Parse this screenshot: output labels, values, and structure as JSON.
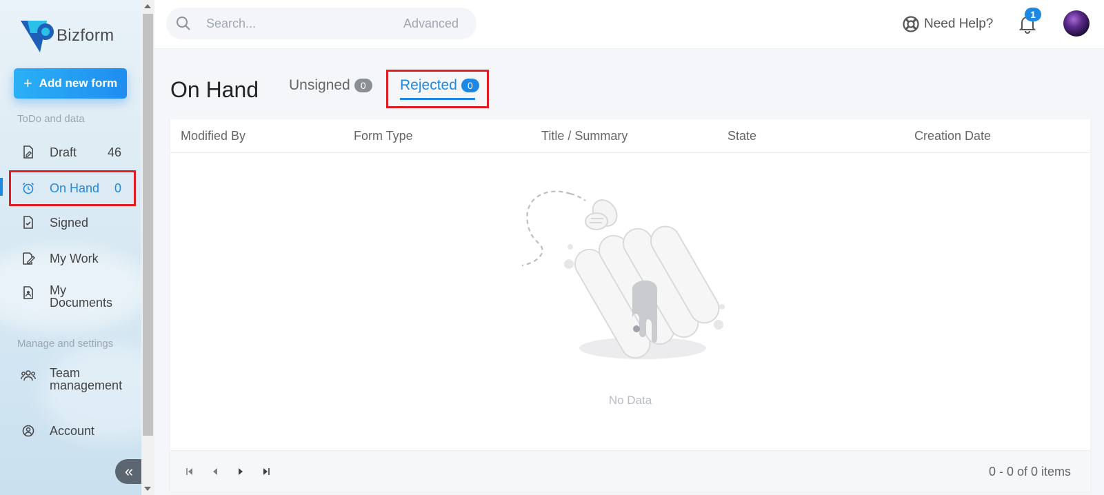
{
  "app": {
    "name": "Bizform"
  },
  "sidebar": {
    "add_button_label": "Add new form",
    "section_todo": "ToDo and data",
    "section_manage": "Manage and settings",
    "items": [
      {
        "label": "Draft",
        "count": "46",
        "icon": "file-edit-icon"
      },
      {
        "label": "On Hand",
        "count": "0",
        "icon": "alarm-clock-icon"
      },
      {
        "label": "Signed",
        "icon": "file-check-icon"
      },
      {
        "label": "My Work",
        "icon": "pen-document-icon"
      },
      {
        "label_line1": "My",
        "label_line2": "Documents",
        "icon": "document-user-icon"
      },
      {
        "label_line1": "Team",
        "label_line2": "management",
        "icon": "team-icon"
      },
      {
        "label": "Account",
        "icon": "user-circle-icon"
      }
    ]
  },
  "header": {
    "search_placeholder": "Search...",
    "advanced_label": "Advanced",
    "help_label": "Need Help?",
    "notification_count": "1"
  },
  "main": {
    "title": "On Hand",
    "tabs": [
      {
        "label": "Unsigned",
        "count": "0"
      },
      {
        "label": "Rejected",
        "count": "0",
        "active": true
      }
    ],
    "table": {
      "columns": [
        "Modified By",
        "Form Type",
        "Title / Summary",
        "State",
        "Creation Date"
      ],
      "rows": [],
      "empty_text": "No Data",
      "pagination_info": "0 - 0 of 0 items"
    }
  },
  "colors": {
    "accent": "#1e88e5",
    "highlight_box": "#e01b24",
    "button_gradient_start": "#2bb0f5",
    "button_gradient_end": "#1f8df0"
  }
}
